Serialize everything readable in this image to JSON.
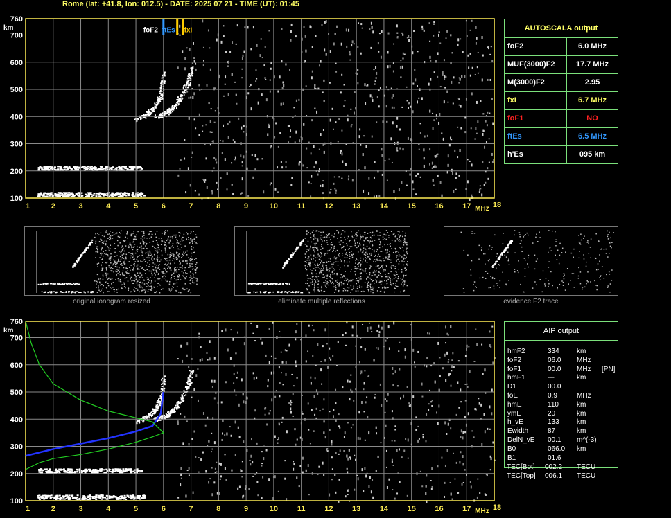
{
  "header": {
    "title": "Rome (lat: +41.8, lon: 012.5) - DATE: 2025 07 21 - TIME (UT): 01:45"
  },
  "axes": {
    "y_ticks": [
      "760",
      "700",
      "600",
      "500",
      "400",
      "300",
      "200",
      "100"
    ],
    "y_unit": "km",
    "x_ticks": [
      "1",
      "2",
      "3",
      "4",
      "5",
      "6",
      "7",
      "8",
      "9",
      "10",
      "11",
      "12",
      "13",
      "14",
      "15",
      "16",
      "17",
      "18"
    ],
    "x_unit": "MHz"
  },
  "markers": {
    "foF2": "foF2",
    "ftEs": "ftEs",
    "fxI": "fxI"
  },
  "autoscala": {
    "title": "AUTOSCALA output",
    "rows": [
      {
        "key": "foF2",
        "value": "6.0 MHz",
        "color": "#ffffff"
      },
      {
        "key": "MUF(3000)F2",
        "value": "17.7 MHz",
        "color": "#ffffff"
      },
      {
        "key": "M(3000)F2",
        "value": "2.95",
        "color": "#ffffff"
      },
      {
        "key": "fxI",
        "value": "6.7 MHz",
        "color": "#ffff66"
      },
      {
        "key": "foF1",
        "value": "NO",
        "color": "#ff2222"
      },
      {
        "key": "ftEs",
        "value": "6.5 MHz",
        "color": "#3399ff"
      },
      {
        "key": "h'Es",
        "value": "095     km",
        "color": "#ffffff"
      }
    ]
  },
  "thumbnails": [
    {
      "caption": "original ionogram resized"
    },
    {
      "caption": "eliminate multiple reflections"
    },
    {
      "caption": "evidence F2 trace"
    }
  ],
  "aip": {
    "title": "AIP output",
    "rows": [
      {
        "name": "hmF2",
        "value": "334",
        "unit": "km"
      },
      {
        "name": "foF2",
        "value": "06.0",
        "unit": "MHz"
      },
      {
        "name": "foF1",
        "value": "00.0",
        "unit": "MHz",
        "extra": "[PN]"
      },
      {
        "name": "hmF1",
        "value": "---",
        "unit": "km"
      },
      {
        "name": "D1",
        "value": "00.0",
        "unit": ""
      },
      {
        "name": "foE",
        "value": "0.9",
        "unit": "MHz"
      },
      {
        "name": "hmE",
        "value": "110",
        "unit": "km"
      },
      {
        "name": "ymE",
        "value": "20",
        "unit": "km"
      },
      {
        "name": "h_vE",
        "value": "133",
        "unit": "km"
      },
      {
        "name": "Ewidth",
        "value": "87",
        "unit": "km"
      },
      {
        "name": "DelN_vE",
        "value": "00.1",
        "unit": "m^(-3)"
      },
      {
        "name": "B0",
        "value": "066.0",
        "unit": "km"
      },
      {
        "name": "B1",
        "value": "01.6",
        "unit": ""
      }
    ],
    "tec": [
      {
        "name": "TEC[Bot]",
        "value": "002.2",
        "unit": "TECU"
      },
      {
        "name": "TEC[Top]",
        "value": "006.1",
        "unit": "TECU"
      }
    ]
  },
  "chart_data": [
    {
      "type": "scatter",
      "xlim": [
        1,
        18
      ],
      "ylim": [
        100,
        760
      ],
      "xlabel": "MHz",
      "ylabel": "km",
      "grid": true,
      "traces": [
        {
          "layer": "E",
          "x_range": [
            1.4,
            5.3
          ],
          "height": 115
        },
        {
          "layer": "Es-multiple",
          "x_range": [
            1.4,
            5.2
          ],
          "height": 212
        },
        {
          "layer": "F2-ordinary",
          "x": [
            5.0,
            5.4,
            5.7,
            5.9,
            6.0
          ],
          "y": [
            390,
            410,
            440,
            480,
            560
          ]
        },
        {
          "layer": "F2-extraordinary",
          "x": [
            5.7,
            6.0,
            6.3,
            6.6,
            6.9,
            7.0
          ],
          "y": [
            400,
            410,
            430,
            470,
            530,
            580
          ]
        }
      ],
      "markers": [
        {
          "name": "foF2",
          "x": 6.0,
          "color": "#3399ff"
        },
        {
          "name": "ftEs",
          "x": 6.5,
          "color": "#ffcc00"
        },
        {
          "name": "fxI",
          "x": 6.7,
          "color": "#ffcc00"
        }
      ]
    },
    {
      "type": "line",
      "xlim": [
        1,
        18
      ],
      "ylim": [
        100,
        760
      ],
      "xlabel": "MHz",
      "ylabel": "km",
      "grid": true,
      "series": [
        {
          "x": [
            1.0,
            2.0,
            3.0,
            4.0,
            5.0,
            5.6,
            5.9,
            6.0
          ],
          "y": [
            265,
            290,
            310,
            330,
            355,
            375,
            420,
            500
          ],
          "color": "#2233ff"
        },
        {
          "x": [
            1.0,
            1.5,
            2.0,
            3.0,
            4.0,
            5.0,
            5.6,
            6.0,
            5.6,
            4.0,
            3.0,
            2.0,
            1.5,
            1.2,
            1.0
          ],
          "y": [
            215,
            240,
            255,
            270,
            290,
            315,
            335,
            350,
            390,
            430,
            470,
            530,
            600,
            680,
            760
          ],
          "color": "#22cc22"
        }
      ]
    }
  ]
}
